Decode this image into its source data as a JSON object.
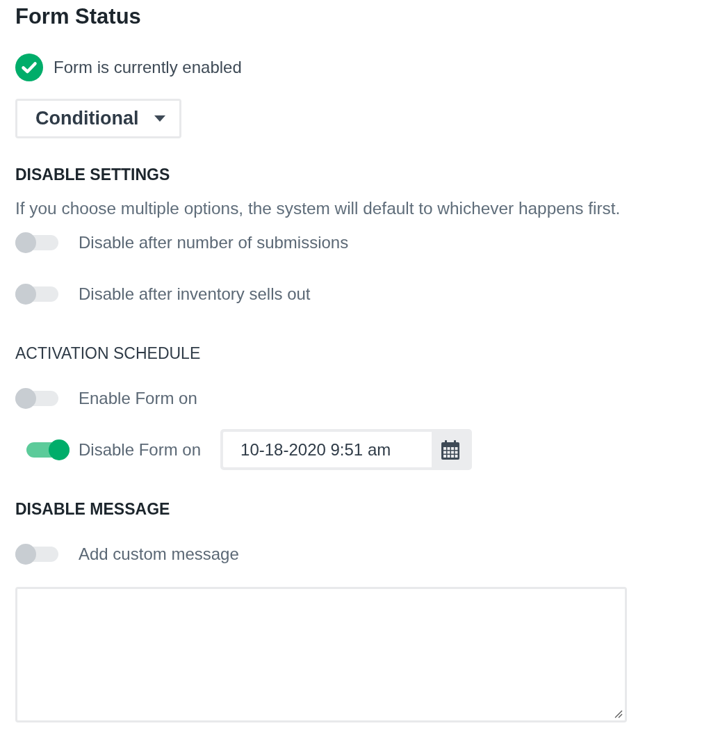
{
  "title": "Form Status",
  "status": {
    "text": "Form is currently enabled",
    "enabled": true
  },
  "mode_dropdown": {
    "value": "Conditional"
  },
  "sections": [
    {
      "heading": "DISABLE SETTINGS",
      "bold": true,
      "note": "If you choose multiple options, the system will default to whichever happens first.",
      "options": [
        {
          "label": "Disable after number of submissions",
          "on": false
        },
        {
          "label": "Disable after inventory sells out",
          "on": false
        }
      ]
    },
    {
      "heading": "ACTIVATION SCHEDULE",
      "bold": false,
      "options": [
        {
          "label": "Enable Form on",
          "on": false
        },
        {
          "label": "Disable Form on",
          "on": true,
          "date_field": {
            "value": "10-18-2020 9:51 am"
          }
        }
      ]
    },
    {
      "heading": "DISABLE MESSAGE",
      "bold": true,
      "options": [
        {
          "label": "Add custom message",
          "on": false
        }
      ],
      "message_box": {
        "resizable": true
      }
    }
  ]
}
